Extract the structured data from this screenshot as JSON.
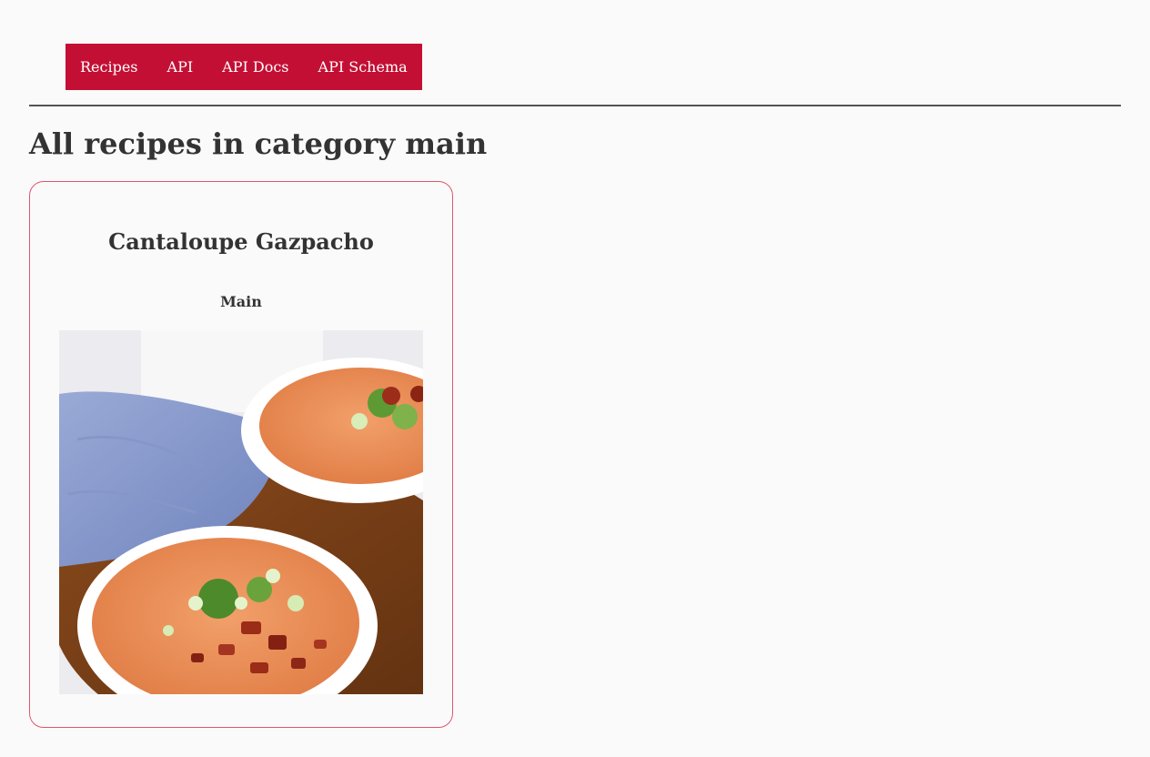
{
  "nav": {
    "items": [
      {
        "label": "Recipes"
      },
      {
        "label": "API"
      },
      {
        "label": "API Docs"
      },
      {
        "label": "API Schema"
      }
    ]
  },
  "page": {
    "title": "All recipes in category main"
  },
  "recipes": [
    {
      "title": "Cantaloupe Gazpacho",
      "category": "Main"
    }
  ],
  "colors": {
    "nav_background": "#c40f34",
    "card_border": "#e0566f",
    "background": "#fafafa",
    "text": "#333333"
  }
}
